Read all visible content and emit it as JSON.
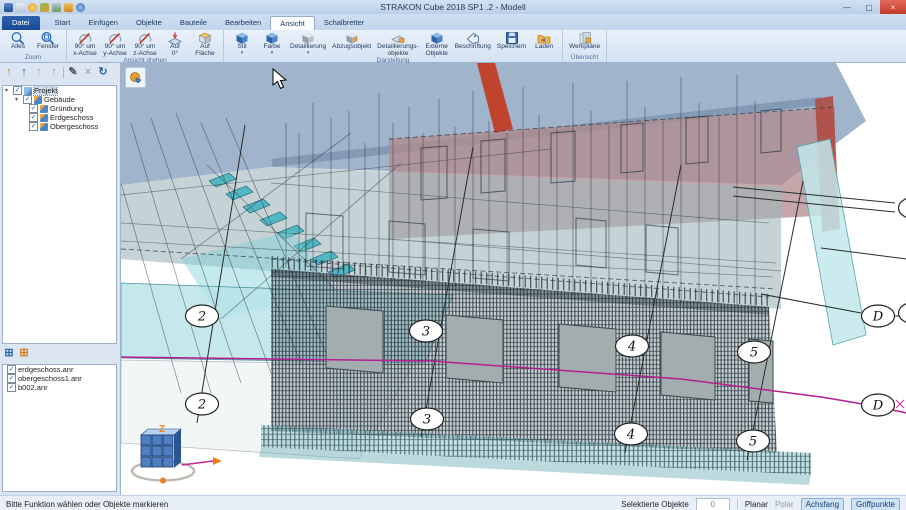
{
  "window": {
    "title": "STRAKON Cube 2018 SP1 .2 - Modell",
    "quick_access_icons": [
      "save-icon",
      "open-icon",
      "bulb-icon",
      "measure-icon",
      "tools-icon",
      "folder-icon",
      "help-icon"
    ]
  },
  "ribbon": {
    "file_tab": "Datei",
    "tabs": [
      {
        "label": "Start"
      },
      {
        "label": "Einfügen"
      },
      {
        "label": "Objekte"
      },
      {
        "label": "Bauteile"
      },
      {
        "label": "Bearbeiten"
      },
      {
        "label": "Ansicht",
        "active": true
      },
      {
        "label": "Schalbretter"
      }
    ],
    "groups": [
      {
        "label": "Zoom",
        "buttons": [
          {
            "line1": "Alles"
          },
          {
            "line1": "Fenster"
          }
        ]
      },
      {
        "label": "Ansicht drehen",
        "buttons": [
          {
            "line1": "90° um",
            "line2": "x-Achse"
          },
          {
            "line1": "90° um",
            "line2": "y-Achse"
          },
          {
            "line1": "90° um",
            "line2": "z-Achse"
          },
          {
            "line1": "Auf",
            "line2": "0°"
          },
          {
            "line1": "Auf",
            "line2": "Fläche"
          }
        ]
      },
      {
        "label": "Darstellung",
        "buttons": [
          {
            "line1": "Stil",
            "dropdown": true
          },
          {
            "line1": "Farbe",
            "dropdown": true
          },
          {
            "line1": "Detaillierung",
            "dropdown": true
          },
          {
            "line1": "Abzugsobjekt"
          },
          {
            "line1": "Detaillierungs-",
            "line2": "objekte"
          },
          {
            "line1": "Externe",
            "line2": "Objekte"
          },
          {
            "line1": "Beschriftung"
          },
          {
            "line1": "Speichern"
          },
          {
            "line1": "Laden"
          }
        ]
      },
      {
        "label": "Übersicht",
        "buttons": [
          {
            "line1": "Werkpläne"
          }
        ]
      }
    ]
  },
  "tree_panel": {
    "toolbar_icons": [
      "insert-building-icon",
      "move-up-icon",
      "move-up-disabled-icon",
      "move-top-disabled-icon",
      "edit-pencil-icon",
      "delete-disabled-icon",
      "refresh-icon"
    ],
    "items": [
      {
        "label": "Projekt",
        "level": 0,
        "checked": true,
        "selected": true
      },
      {
        "label": "Gebäude",
        "level": 1,
        "checked": true
      },
      {
        "label": "Gründung",
        "level": 2,
        "checked": true
      },
      {
        "label": "Erdgeschoss",
        "level": 2,
        "checked": true
      },
      {
        "label": "Obergeschoss",
        "level": 2,
        "checked": true
      }
    ]
  },
  "files_panel": {
    "toolbar_icons": [
      "add-layout-icon",
      "import-layout-icon"
    ],
    "items": [
      {
        "label": "erdgeschoss.anr",
        "checked": true
      },
      {
        "label": "obergeschoss1.anr",
        "checked": true
      },
      {
        "label": "b002.anr",
        "checked": true
      }
    ]
  },
  "viewport": {
    "axis_bubbles": {
      "b2": "2",
      "b3": "3",
      "b4": "4",
      "b5": "5",
      "bd": "D"
    },
    "gizmo_z": "Z"
  },
  "status_bar": {
    "message": "Bitte Funktion wählen oder Objekte markieren",
    "selected_label": "Selektierte Objekte",
    "selected_count": "0",
    "toggles": [
      {
        "label": "Planar",
        "state": "on"
      },
      {
        "label": "Polar",
        "state": "off"
      },
      {
        "label": "Achsfang",
        "state": "highlighted"
      },
      {
        "label": "Griffpunkte",
        "state": "highlighted"
      }
    ]
  }
}
